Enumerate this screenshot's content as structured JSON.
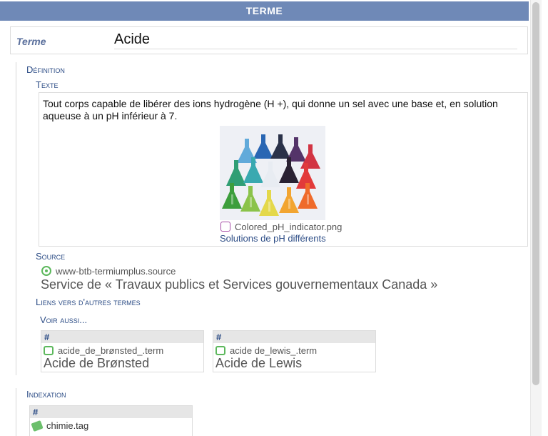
{
  "header": {
    "title": "TERME"
  },
  "term": {
    "label": "Terme",
    "value": "Acide"
  },
  "definition": {
    "section_title": "Définition",
    "texte_title": "Texte",
    "text": "Tout corps capable de libérer des ions hydrogène (H +), qui donne un sel avec une base et, en solution aqueuse à un pH inférieur à 7.",
    "image": {
      "icon": "image-file-icon",
      "file": "Colored_pH_indicator.png",
      "caption": "Solutions de pH différents"
    },
    "source_title": "Source",
    "source": {
      "icon": "source-target-icon",
      "file": "www-btb-termiumplus.source",
      "name": "Service de « Travaux publics et Services gouvernementaux Canada »"
    },
    "links_title": "Liens vers d'autres termes",
    "see_also_title": "Voir aussi...",
    "see_also": [
      {
        "hash": "#",
        "icon": "term-quote-icon",
        "file": "acide_de_brønsted_.term",
        "name": "Acide de Brønsted"
      },
      {
        "hash": "#",
        "icon": "term-quote-icon",
        "file": "acide de_lewis_.term",
        "name": "Acide de Lewis"
      }
    ]
  },
  "indexation": {
    "title": "Indexation",
    "tags": [
      {
        "hash": "#",
        "icon": "tag-icon",
        "file": "chimie.tag"
      }
    ]
  },
  "colors": {
    "header_bg": "#6f89b7",
    "link_blue": "#2d4d86",
    "source_green": "#5cb85c",
    "image_icon_purple": "#a64ca6"
  }
}
